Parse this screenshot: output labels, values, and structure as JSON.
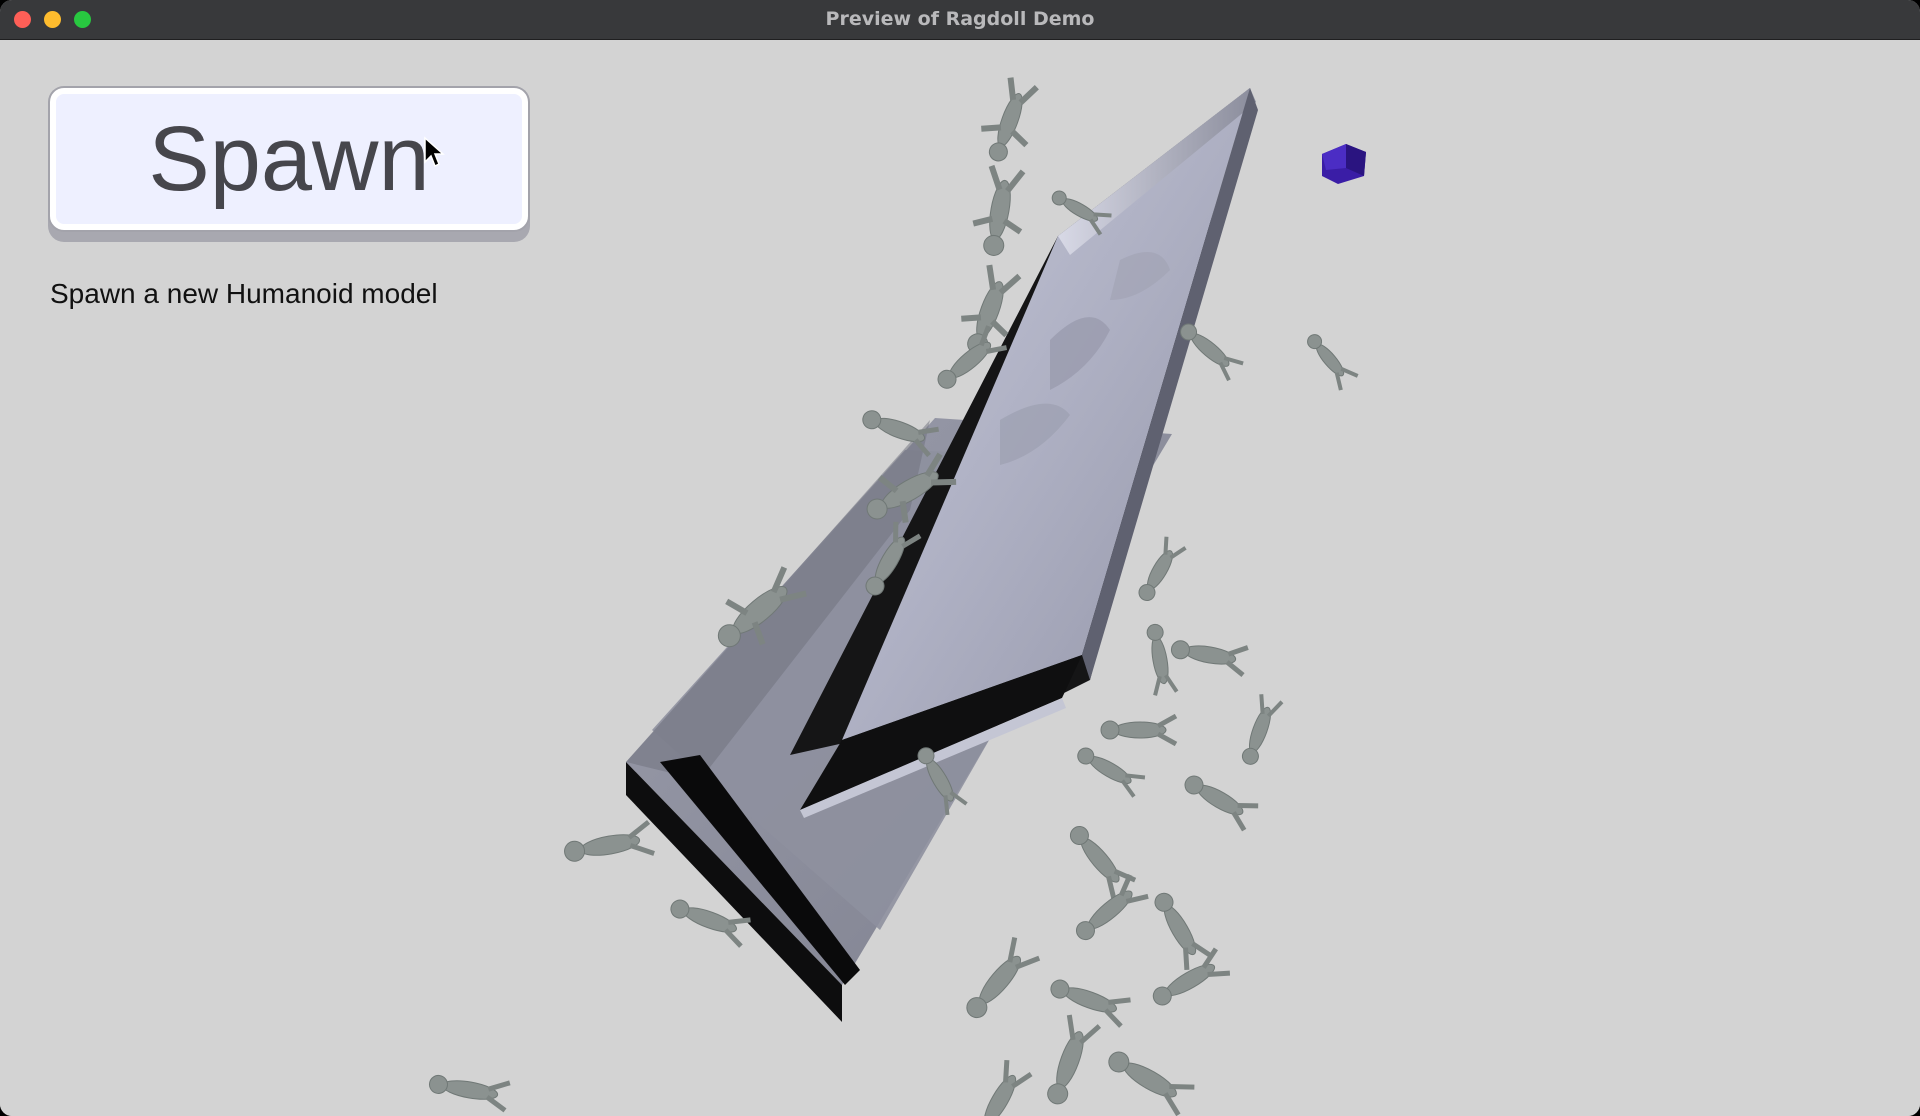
{
  "window": {
    "title": "Preview of Ragdoll Demo",
    "controls": {
      "close_color": "#fe5f57",
      "minimize_color": "#febc2e",
      "maximize_color": "#28c840"
    }
  },
  "ui": {
    "spawn_button_label": "Spawn",
    "spawn_description": "Spawn a new Humanoid model"
  },
  "scene": {
    "background_color": "#d3d3d3",
    "ragdoll_color": "#8b9290",
    "panel_face_color": "#b4b6c8",
    "panel_dark_color": "#0c0c0d",
    "cube_color": "#3b1fa8"
  }
}
